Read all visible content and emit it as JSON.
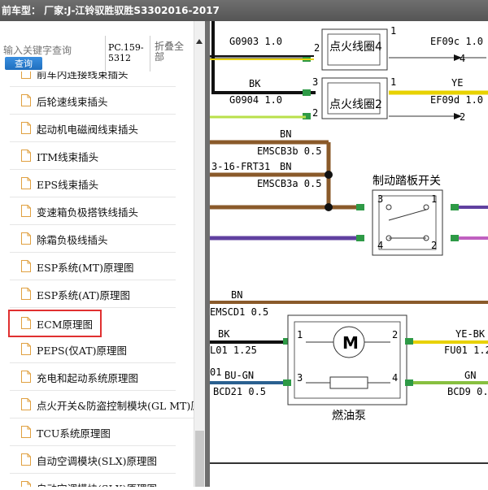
{
  "window": {
    "title": "前车型：  厂家:J-江铃驭胜驭胜S3302016-2017"
  },
  "search": {
    "placeholder": "输入关键字查询",
    "button_label": "查询",
    "pc_label": "PC.159-5312",
    "fold_label": "折叠全部"
  },
  "list": {
    "items": [
      {
        "label": "前车内连接线束插头",
        "selected": false
      },
      {
        "label": "后轮速线束插头",
        "selected": false
      },
      {
        "label": "起动机电磁阀线束插头",
        "selected": false
      },
      {
        "label": "ITM线束插头",
        "selected": false
      },
      {
        "label": "EPS线束插头",
        "selected": false
      },
      {
        "label": "变速箱负极搭铁线插头",
        "selected": false
      },
      {
        "label": "除霜负极线插头",
        "selected": false
      },
      {
        "label": "ESP系统(MT)原理图",
        "selected": false
      },
      {
        "label": "ESP系统(AT)原理图",
        "selected": false
      },
      {
        "label": "ECM原理图",
        "selected": true
      },
      {
        "label": "PEPS(仅AT)原理图",
        "selected": false
      },
      {
        "label": "充电和起动系统原理图",
        "selected": false
      },
      {
        "label": "点火开关&防盗控制模块(GL MT)原理图",
        "selected": false
      },
      {
        "label": "TCU系统原理图",
        "selected": false
      },
      {
        "label": "自动空调模块(SLX)原理图",
        "selected": false
      },
      {
        "label": "自动空调模块(SLX)原理图",
        "selected": false
      }
    ]
  },
  "diagram": {
    "coil4": {
      "label": "点火线圈4",
      "wire_left": "G0903 1.0",
      "wire_right": "EF09c 1.0",
      "out": "4",
      "pin_l": "2",
      "pin_r": "1"
    },
    "coil2": {
      "label": "点火线圈2",
      "color_l": "BK",
      "wire_left": "G0904 1.0",
      "color_r": "YE",
      "wire_right": "EF09d 1.0",
      "out": "2",
      "pin_l_top": "3",
      "pin_l_bot": "2",
      "pin_r": "1"
    },
    "brake": {
      "title": "制动踏板开关",
      "bn1": "BN",
      "wire_b": "EMSCB3b 0.5",
      "frt": "3-16-FRT31",
      "bn2": "BN",
      "wire_a": "EMSCB3a 0.5",
      "pin3": "3",
      "pin1": "1",
      "pin4": "4",
      "pin2": "2"
    },
    "pump": {
      "label": "燃油泵",
      "motor": "M",
      "bn": "BN",
      "emscd": "EMSCD1 0.5",
      "bk": "BK",
      "lo": "L01 1.25",
      "yebk": "YE-BK",
      "fu": "FU01 1.25",
      "n01": "01",
      "bugn": "BU-GN",
      "bcd": "BCD21 0.5",
      "gn": "GN",
      "bcd9": "BCD9 0.5",
      "p1": "1",
      "p2": "2",
      "p3": "3",
      "p4": "4"
    }
  }
}
